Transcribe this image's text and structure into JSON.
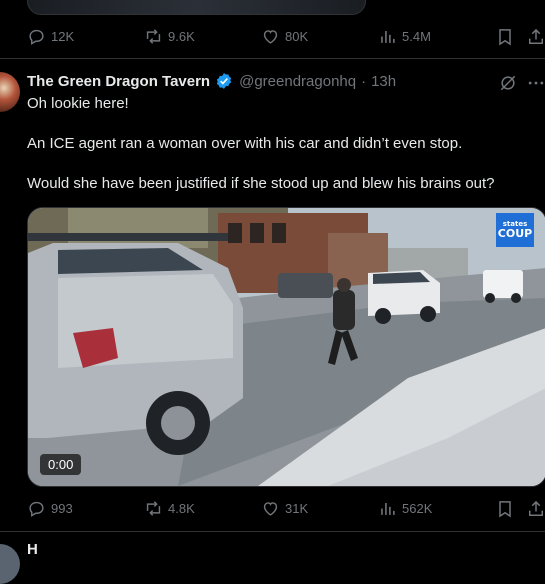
{
  "top_tweet": {
    "actions": {
      "replies": "12K",
      "reposts": "9.6K",
      "likes": "80K",
      "views": "5.4M"
    }
  },
  "tweet": {
    "author_name": "The Green Dragon Tavern",
    "handle": "@greendragonhq",
    "separator": "·",
    "time": "13h",
    "lines": [
      "Oh lookie here!",
      "An ICE agent ran a woman over with his car and didn’t even stop.",
      "Would she have been justified if she stood up and blew his brains out?"
    ],
    "video": {
      "timestamp": "0:00",
      "logo_line1": "states",
      "logo_line2": "COUP"
    },
    "actions": {
      "replies": "993",
      "reposts": "4.8K",
      "likes": "31K",
      "views": "562K"
    }
  },
  "next_tweet": {
    "author_name_partial": "H"
  },
  "colors": {
    "background": "#000000",
    "text": "#e7e9ea",
    "secondary_text": "#71767b",
    "divider": "#2f3336",
    "verified": "#1d9bf0"
  },
  "icons": [
    "reply-icon",
    "repost-icon",
    "like-icon",
    "views-icon",
    "bookmark-icon",
    "share-icon",
    "grok-icon",
    "more-icon",
    "verified-badge-icon"
  ]
}
